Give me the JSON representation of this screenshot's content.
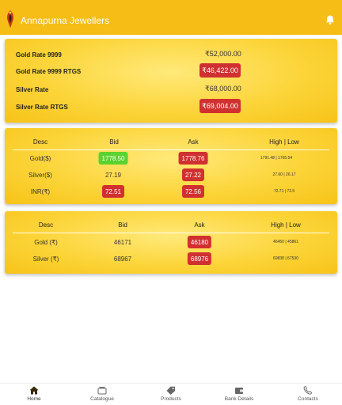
{
  "app": {
    "title": "Annapurna Jewellers"
  },
  "rates": [
    {
      "label": "Gold Rate 9999",
      "value": "₹52,000.00",
      "badge": false
    },
    {
      "label": "Gold Rate 9999 RTGS",
      "value": "₹46,422.00",
      "badge": true
    },
    {
      "label": "Silver Rate",
      "value": "₹68,000.00",
      "badge": false
    },
    {
      "label": "Silver Rate RTGS",
      "value": "₹69,004.00",
      "badge": true
    }
  ],
  "table1": {
    "headers": [
      "Desc",
      "Bid",
      "Ask",
      "High | Low"
    ],
    "rows": [
      {
        "desc": "Gold($)",
        "bid": "1778.50",
        "ask": "1778.76",
        "highlow": "1791.48 | 1765.54"
      },
      {
        "desc": "Silver($)",
        "bid": "27.19",
        "ask": "27.22",
        "highlow": "27.60 | 26.17"
      },
      {
        "desc": "INR(₹)",
        "bid": "72.51",
        "ask": "72.56",
        "highlow": "72.71 | 72.5"
      }
    ]
  },
  "table2": {
    "headers": [
      "Desc",
      "Bid",
      "Ask",
      "High | Low"
    ],
    "rows": [
      {
        "desc": "Gold (₹)",
        "bid": "46171",
        "ask": "46180",
        "highlow": "46450 | 45861"
      },
      {
        "desc": "Silver (₹)",
        "bid": "68967",
        "ask": "68976",
        "highlow": "69838 | 67530"
      }
    ]
  },
  "nav": {
    "items": [
      {
        "label": "Home",
        "icon": "home-icon"
      },
      {
        "label": "Catalogue",
        "icon": "catalogue-icon"
      },
      {
        "label": "Products",
        "icon": "tag-icon"
      },
      {
        "label": "Bank Details",
        "icon": "wallet-icon"
      },
      {
        "label": "Contacts",
        "icon": "phone-icon"
      }
    ]
  },
  "colors": {
    "brand": "#f5bd16",
    "badge_red": "#d03030",
    "badge_green": "#5bd22e"
  }
}
